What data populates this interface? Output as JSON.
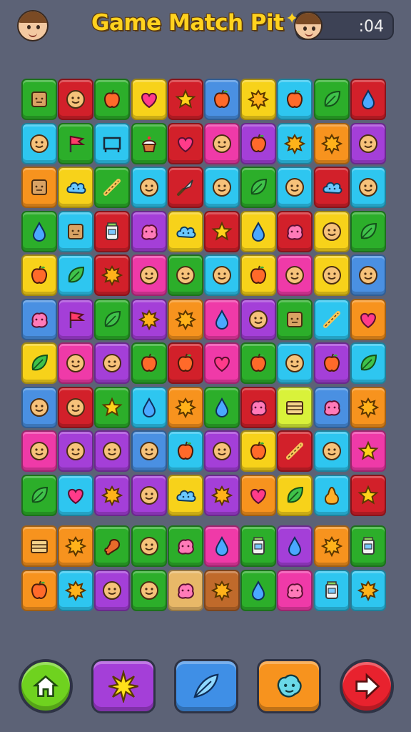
{
  "header": {
    "title": "Game Match Pit",
    "timer": ":04",
    "player_avatar_icon": "player-avatar-icon",
    "opponent_avatar_icon": "opponent-avatar-icon"
  },
  "palette": {
    "G": "#2cae2a",
    "R": "#d2202a",
    "Y": "#f7d21a",
    "C": "#2ec6f0",
    "P": "#a43fd8",
    "K": "#ef3aa8",
    "O": "#f7931e",
    "B": "#4a90e2",
    "T": "#e8b868",
    "M": "#d9f23a",
    "D": "#c06a2b"
  },
  "board": {
    "rows": [
      [
        {
          "c": "G",
          "i": "box-face"
        },
        {
          "c": "R",
          "i": "face"
        },
        {
          "c": "G",
          "i": "apple"
        },
        {
          "c": "Y",
          "i": "heart"
        },
        {
          "c": "R",
          "i": "star"
        },
        {
          "c": "B",
          "i": "apple"
        },
        {
          "c": "Y",
          "i": "splat"
        },
        {
          "c": "C",
          "i": "apple"
        },
        {
          "c": "G",
          "i": "leaf"
        },
        {
          "c": "R",
          "i": "drop"
        }
      ],
      [
        {
          "c": "C",
          "i": "face"
        },
        {
          "c": "G",
          "i": "flag"
        },
        {
          "c": "C",
          "i": "frame"
        },
        {
          "c": "G",
          "i": "cupcake"
        },
        {
          "c": "R",
          "i": "heart"
        },
        {
          "c": "K",
          "i": "face"
        },
        {
          "c": "P",
          "i": "apple"
        },
        {
          "c": "C",
          "i": "splat"
        },
        {
          "c": "O",
          "i": "splat"
        },
        {
          "c": "P",
          "i": "face"
        }
      ],
      [
        {
          "c": "O",
          "i": "box-face"
        },
        {
          "c": "Y",
          "i": "cloud"
        },
        {
          "c": "G",
          "i": "stick"
        },
        {
          "c": "C",
          "i": "face"
        },
        {
          "c": "R",
          "i": "knife"
        },
        {
          "c": "C",
          "i": "face"
        },
        {
          "c": "G",
          "i": "leaf"
        },
        {
          "c": "C",
          "i": "face"
        },
        {
          "c": "R",
          "i": "cloud"
        },
        {
          "c": "C",
          "i": "face"
        }
      ],
      [
        {
          "c": "G",
          "i": "drop"
        },
        {
          "c": "C",
          "i": "box-face"
        },
        {
          "c": "R",
          "i": "jar"
        },
        {
          "c": "P",
          "i": "blob"
        },
        {
          "c": "Y",
          "i": "cloud"
        },
        {
          "c": "R",
          "i": "star"
        },
        {
          "c": "Y",
          "i": "drop"
        },
        {
          "c": "R",
          "i": "blob"
        },
        {
          "c": "Y",
          "i": "face"
        },
        {
          "c": "G",
          "i": "leaf"
        }
      ],
      [
        {
          "c": "Y",
          "i": "apple"
        },
        {
          "c": "C",
          "i": "leaf"
        },
        {
          "c": "R",
          "i": "splat"
        },
        {
          "c": "K",
          "i": "face"
        },
        {
          "c": "G",
          "i": "face"
        },
        {
          "c": "C",
          "i": "face"
        },
        {
          "c": "Y",
          "i": "apple"
        },
        {
          "c": "K",
          "i": "face"
        },
        {
          "c": "Y",
          "i": "face"
        },
        {
          "c": "B",
          "i": "face"
        }
      ],
      [
        {
          "c": "B",
          "i": "blob"
        },
        {
          "c": "P",
          "i": "flag"
        },
        {
          "c": "G",
          "i": "leaf"
        },
        {
          "c": "P",
          "i": "splat"
        },
        {
          "c": "O",
          "i": "splat"
        },
        {
          "c": "K",
          "i": "drop"
        },
        {
          "c": "P",
          "i": "face"
        },
        {
          "c": "G",
          "i": "box-face"
        },
        {
          "c": "C",
          "i": "stick"
        },
        {
          "c": "O",
          "i": "heart"
        }
      ],
      [
        {
          "c": "Y",
          "i": "leaf"
        },
        {
          "c": "K",
          "i": "face"
        },
        {
          "c": "P",
          "i": "face"
        },
        {
          "c": "G",
          "i": "apple"
        },
        {
          "c": "R",
          "i": "apple"
        },
        {
          "c": "K",
          "i": "heart"
        },
        {
          "c": "G",
          "i": "apple"
        },
        {
          "c": "C",
          "i": "face"
        },
        {
          "c": "P",
          "i": "apple"
        },
        {
          "c": "C",
          "i": "leaf"
        }
      ],
      [
        {
          "c": "B",
          "i": "face"
        },
        {
          "c": "R",
          "i": "face"
        },
        {
          "c": "G",
          "i": "star"
        },
        {
          "c": "C",
          "i": "drop"
        },
        {
          "c": "O",
          "i": "splat"
        },
        {
          "c": "G",
          "i": "drop"
        },
        {
          "c": "R",
          "i": "blob"
        },
        {
          "c": "M",
          "i": "box"
        },
        {
          "c": "B",
          "i": "blob"
        },
        {
          "c": "O",
          "i": "splat"
        }
      ],
      [
        {
          "c": "K",
          "i": "face"
        },
        {
          "c": "P",
          "i": "face"
        },
        {
          "c": "P",
          "i": "face"
        },
        {
          "c": "B",
          "i": "face"
        },
        {
          "c": "C",
          "i": "apple"
        },
        {
          "c": "P",
          "i": "face"
        },
        {
          "c": "Y",
          "i": "apple"
        },
        {
          "c": "R",
          "i": "stick"
        },
        {
          "c": "C",
          "i": "face"
        },
        {
          "c": "K",
          "i": "star"
        }
      ],
      [
        {
          "c": "G",
          "i": "leaf"
        },
        {
          "c": "C",
          "i": "heart"
        },
        {
          "c": "P",
          "i": "splat"
        },
        {
          "c": "P",
          "i": "face"
        },
        {
          "c": "Y",
          "i": "cloud"
        },
        {
          "c": "P",
          "i": "splat"
        },
        {
          "c": "O",
          "i": "heart"
        },
        {
          "c": "Y",
          "i": "leaf"
        },
        {
          "c": "C",
          "i": "pear"
        },
        {
          "c": "R",
          "i": "star"
        }
      ],
      [
        {
          "c": "O",
          "i": "box"
        },
        {
          "c": "O",
          "i": "splat"
        },
        {
          "c": "G",
          "i": "drumstick"
        },
        {
          "c": "G",
          "i": "face"
        },
        {
          "c": "G",
          "i": "blob"
        },
        {
          "c": "K",
          "i": "drop"
        },
        {
          "c": "G",
          "i": "jar"
        },
        {
          "c": "P",
          "i": "drop"
        },
        {
          "c": "O",
          "i": "splat"
        },
        {
          "c": "G",
          "i": "jar"
        }
      ],
      [
        {
          "c": "O",
          "i": "apple"
        },
        {
          "c": "C",
          "i": "splat"
        },
        {
          "c": "P",
          "i": "face"
        },
        {
          "c": "G",
          "i": "face"
        },
        {
          "c": "T",
          "i": "blob"
        },
        {
          "c": "D",
          "i": "splat"
        },
        {
          "c": "G",
          "i": "drop"
        },
        {
          "c": "K",
          "i": "blob"
        },
        {
          "c": "C",
          "i": "jar"
        },
        {
          "c": "C",
          "i": "splat"
        }
      ]
    ]
  },
  "controls": [
    {
      "name": "home-button",
      "icon": "home-icon",
      "color": "#6fd21f"
    },
    {
      "name": "burst-button",
      "icon": "burst-icon",
      "color": "#a43fd8"
    },
    {
      "name": "feather-button",
      "icon": "feather-icon",
      "color": "#3f8fe6"
    },
    {
      "name": "face-button",
      "icon": "face-icon",
      "color": "#f7931e"
    },
    {
      "name": "next-button",
      "icon": "arrow-right-icon",
      "color": "#e8222e"
    }
  ]
}
